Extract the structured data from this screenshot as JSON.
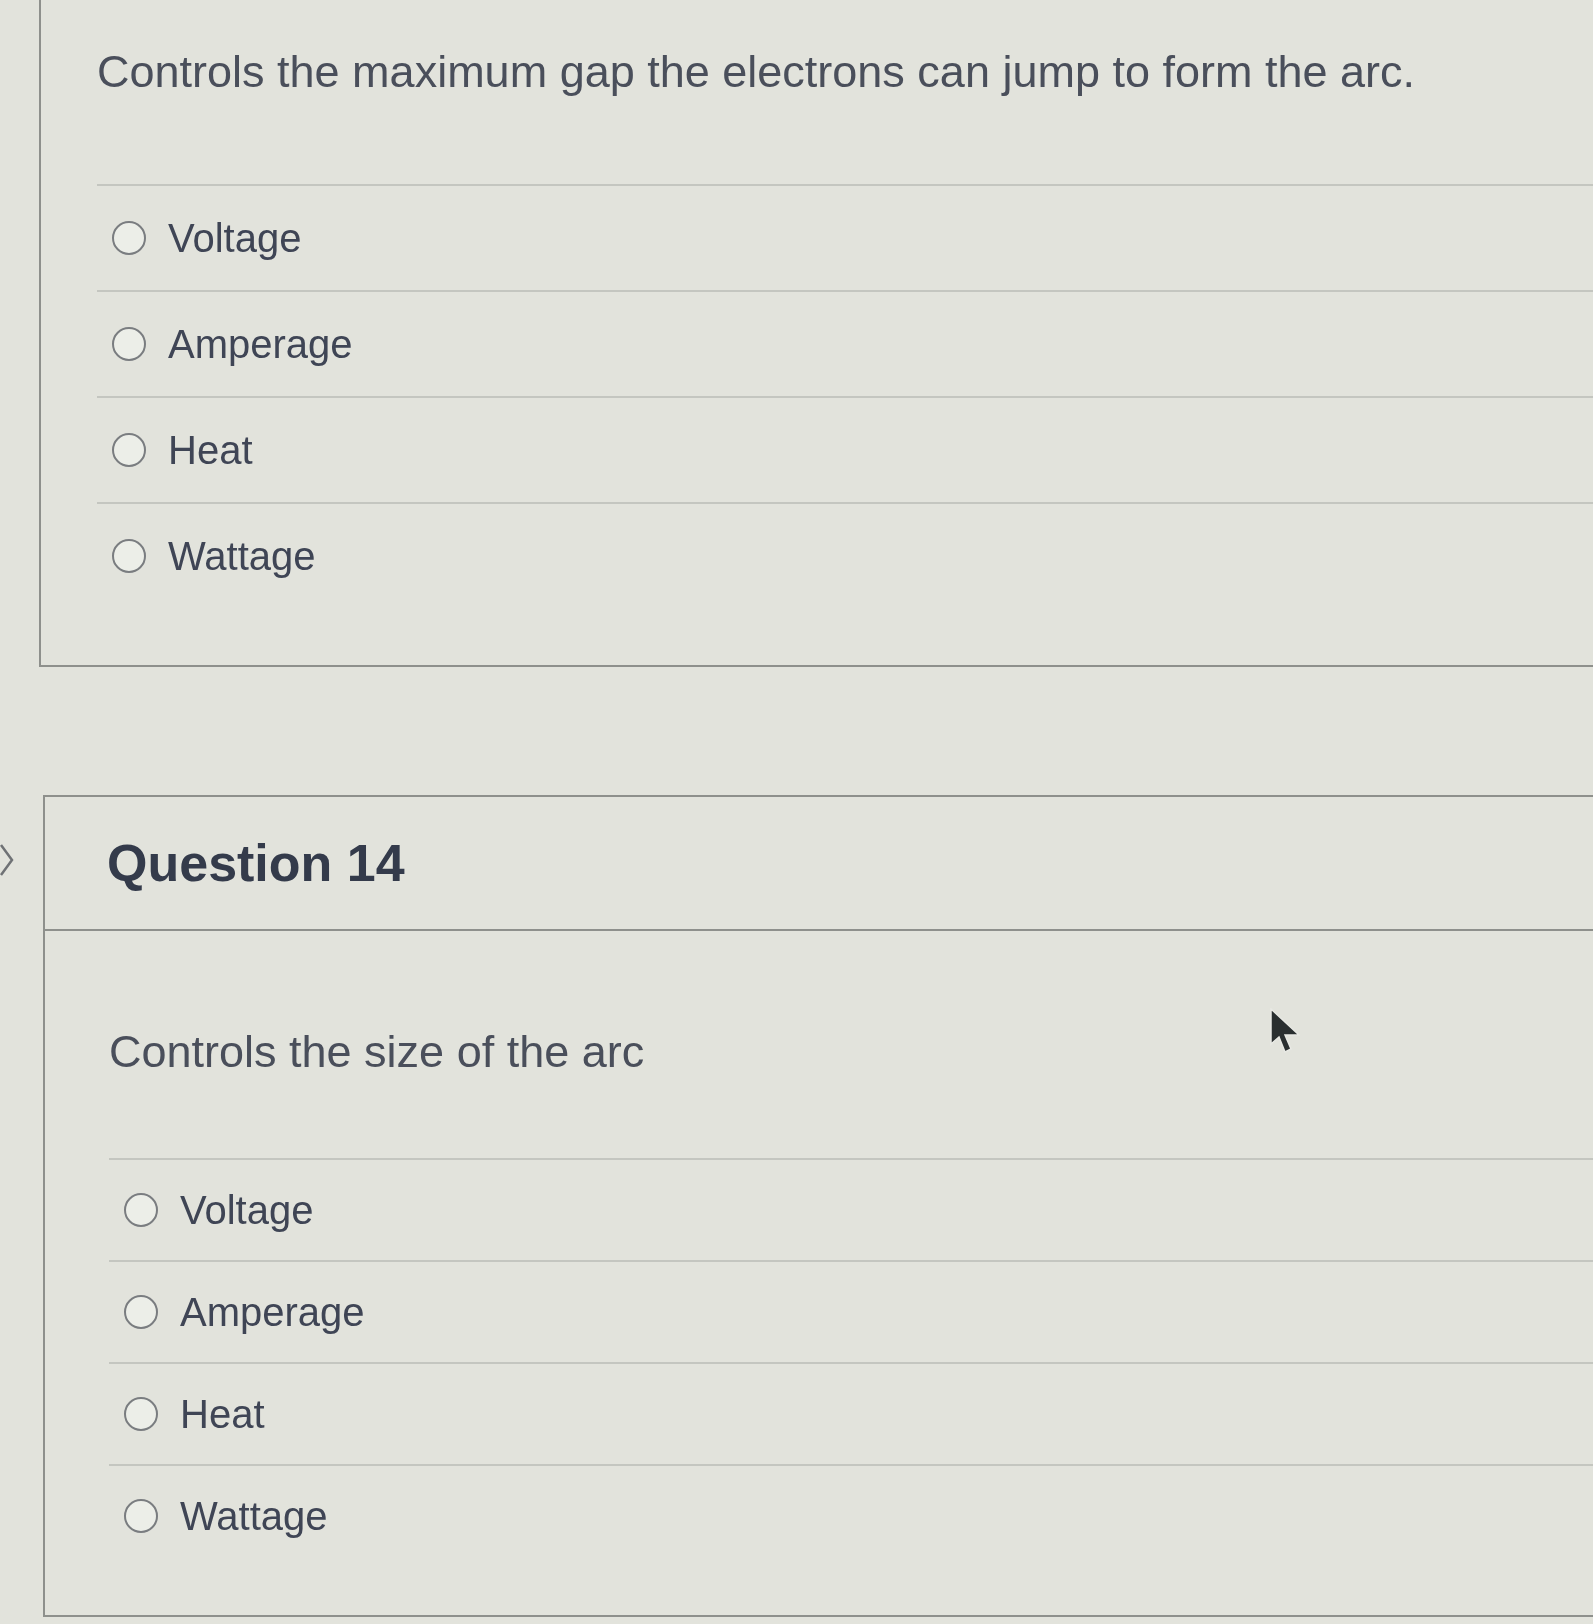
{
  "questions": [
    {
      "prompt": "Controls the maximum gap the electrons can jump to form the arc.",
      "options": [
        {
          "label": "Voltage",
          "selected": false
        },
        {
          "label": "Amperage",
          "selected": false
        },
        {
          "label": "Heat",
          "selected": false
        },
        {
          "label": "Wattage",
          "selected": false
        }
      ]
    },
    {
      "title": "Question 14",
      "prompt": "Controls the size of the arc",
      "options": [
        {
          "label": "Voltage",
          "selected": false
        },
        {
          "label": "Amperage",
          "selected": false
        },
        {
          "label": "Heat",
          "selected": false
        },
        {
          "label": "Wattage",
          "selected": false
        }
      ]
    }
  ]
}
